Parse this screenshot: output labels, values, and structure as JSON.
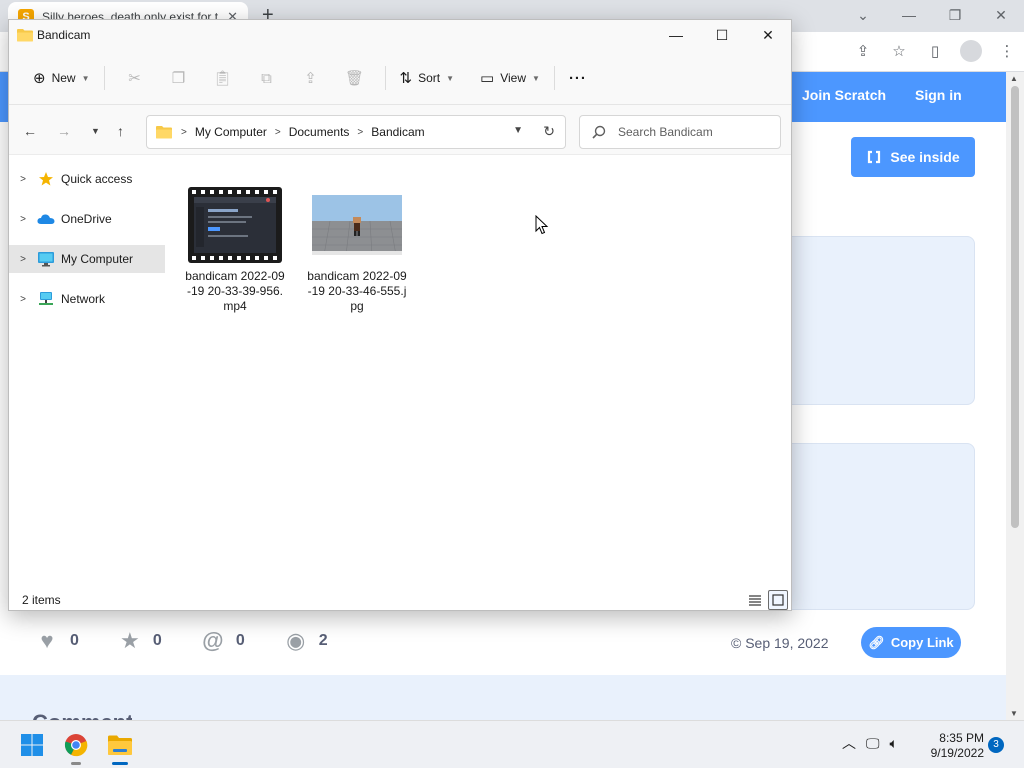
{
  "browser": {
    "tab_title": "Silly heroes, death only exist for t",
    "new_tab_glyph": "+",
    "scratch": {
      "join_label": "Join Scratch",
      "signin_label": "Sign in",
      "see_inside_label": "See inside",
      "stats": [
        {
          "icon": "heart-icon",
          "value": "0"
        },
        {
          "icon": "star-icon",
          "value": "0"
        },
        {
          "icon": "remix-icon",
          "value": "0"
        },
        {
          "icon": "eye-icon",
          "value": "2"
        }
      ],
      "shared_date": "© Sep 19, 2022",
      "copy_link_label": "Copy Link",
      "comments_heading": "Comments"
    }
  },
  "explorer": {
    "window_title": "Bandicam",
    "commands": {
      "new_label": "New",
      "sort_label": "Sort",
      "view_label": "View"
    },
    "address": {
      "crumbs": [
        "My Computer",
        "Documents",
        "Bandicam"
      ]
    },
    "search": {
      "placeholder": "Search Bandicam"
    },
    "nav": [
      {
        "label": "Quick access",
        "icon": "star-icon"
      },
      {
        "label": "OneDrive",
        "icon": "cloud-icon"
      },
      {
        "label": "My Computer",
        "icon": "computer-icon",
        "selected": true
      },
      {
        "label": "Network",
        "icon": "network-icon"
      }
    ],
    "files": [
      {
        "name": "bandicam 2022-09-19 20-33-39-956.mp4",
        "type": "video"
      },
      {
        "name": "bandicam 2022-09-19 20-33-46-555.jpg",
        "type": "image"
      }
    ],
    "status": {
      "item_count": "2 items"
    }
  },
  "taskbar": {
    "time": "8:35 PM",
    "date": "9/19/2022",
    "notification_count": "3"
  },
  "colors": {
    "scratch_blue": "#4c97ff",
    "windows_accent": "#0067c0",
    "folder_yellow": "#f7c948"
  }
}
